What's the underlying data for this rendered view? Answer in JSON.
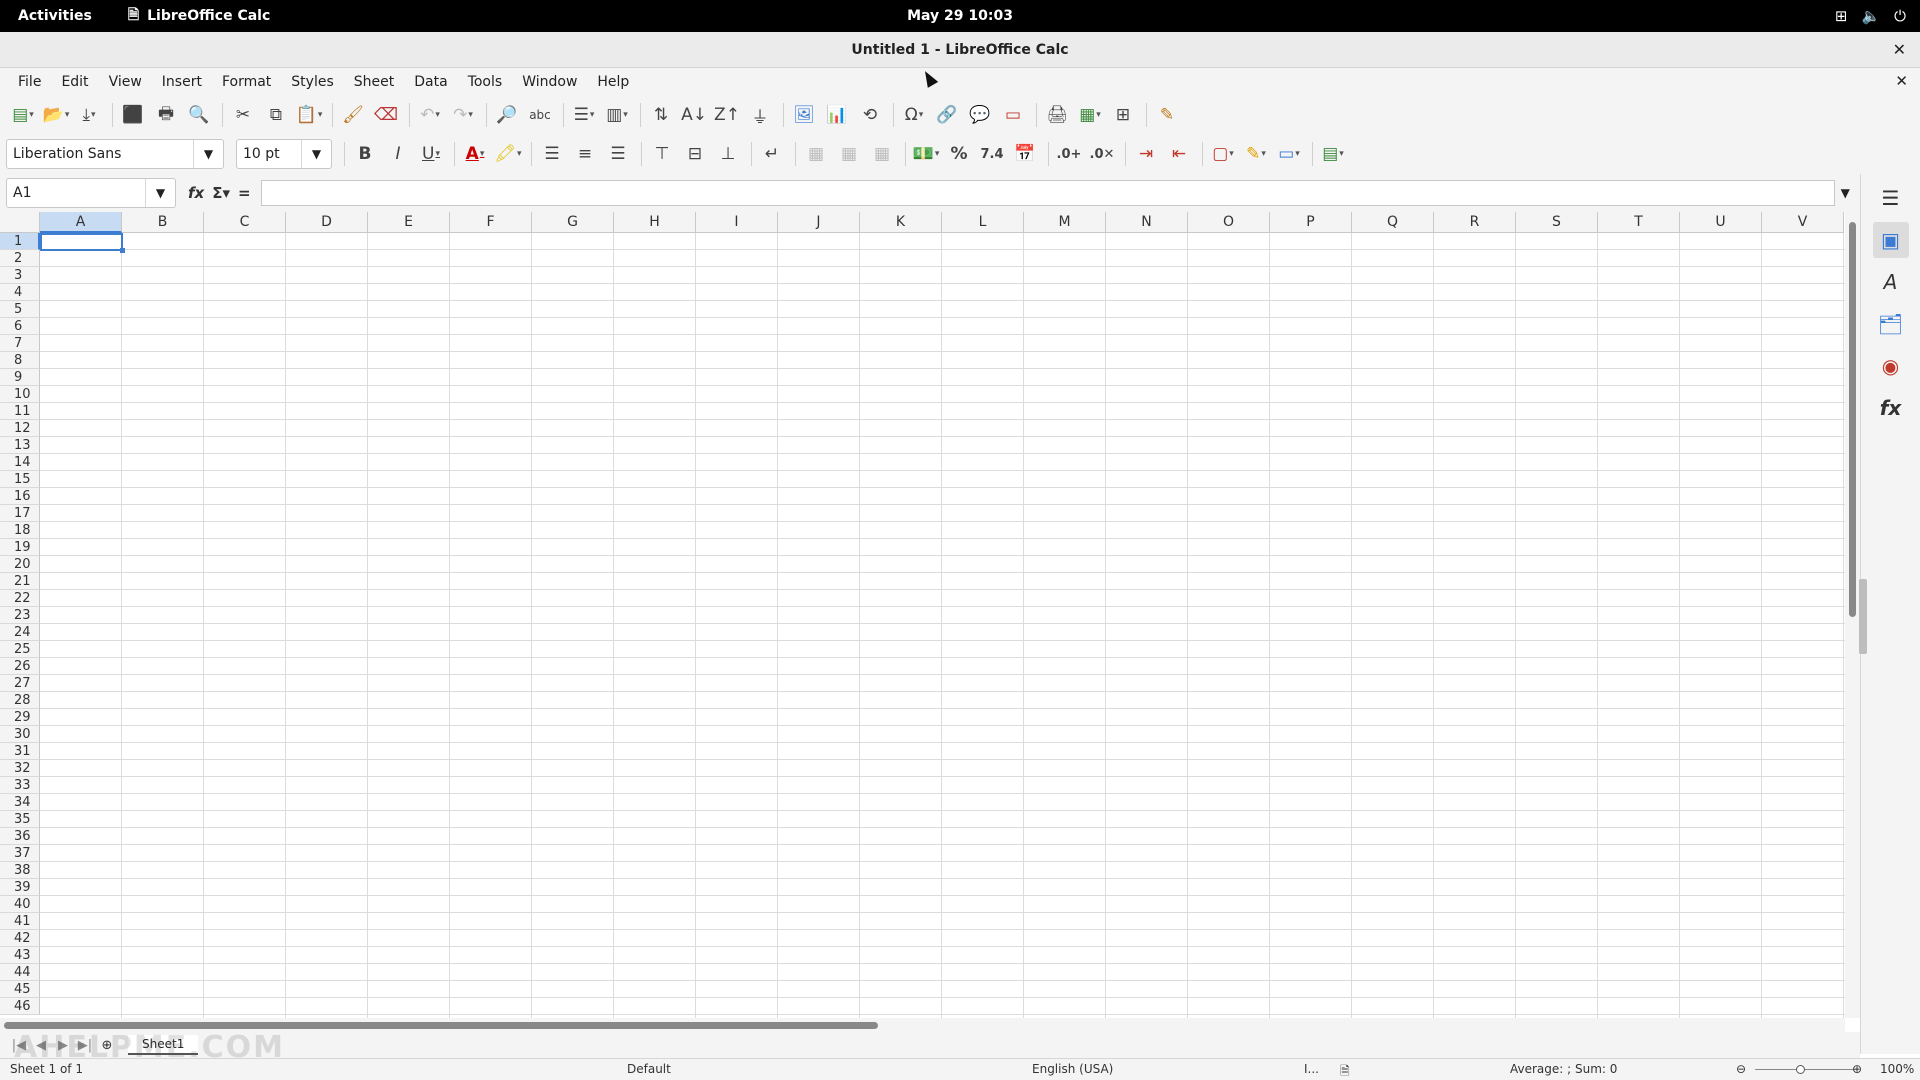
{
  "topbar": {
    "activities": "Activities",
    "app_name": "LibreOffice Calc",
    "clock": "May 29  10:03",
    "tray": [
      "network-icon",
      "volume-icon",
      "power-icon"
    ]
  },
  "window": {
    "title": "Untitled 1 - LibreOffice Calc"
  },
  "menu": [
    "File",
    "Edit",
    "View",
    "Insert",
    "Format",
    "Styles",
    "Sheet",
    "Data",
    "Tools",
    "Window",
    "Help"
  ],
  "format_toolbar": {
    "font_name": "Liberation Sans",
    "font_size": "10 pt"
  },
  "formula_bar": {
    "name_box": "A1",
    "content": ""
  },
  "columns": [
    "A",
    "B",
    "C",
    "D",
    "E",
    "F",
    "G",
    "H",
    "I",
    "J",
    "K",
    "L",
    "M",
    "N",
    "O",
    "P",
    "Q",
    "R",
    "S",
    "T",
    "U",
    "V"
  ],
  "rows": [
    "1",
    "2",
    "3",
    "4",
    "5",
    "6",
    "7",
    "8",
    "9",
    "10",
    "11",
    "12",
    "13",
    "14",
    "15",
    "16",
    "17",
    "18",
    "19",
    "20",
    "21",
    "22",
    "23",
    "24",
    "25",
    "26",
    "27",
    "28",
    "29",
    "30",
    "31",
    "32",
    "33",
    "34",
    "35",
    "36",
    "37",
    "38",
    "39",
    "40",
    "41",
    "42",
    "43",
    "44",
    "45",
    "46"
  ],
  "selected_cell": {
    "column": "A",
    "row": "1"
  },
  "sheets": {
    "tabs": [
      "Sheet1"
    ],
    "active": "Sheet1"
  },
  "watermark": "AHELPME.COM",
  "status": {
    "sheet_info": "Sheet 1 of 1",
    "page_style": "Default",
    "language": "English (USA)",
    "selection_mode": "I...",
    "summary": "Average: ; Sum: 0",
    "zoom": "100%"
  },
  "colors": {
    "selection": "#3d7ed3",
    "header_highlight": "#c7dcf3",
    "chrome": "#f4f4f4"
  }
}
